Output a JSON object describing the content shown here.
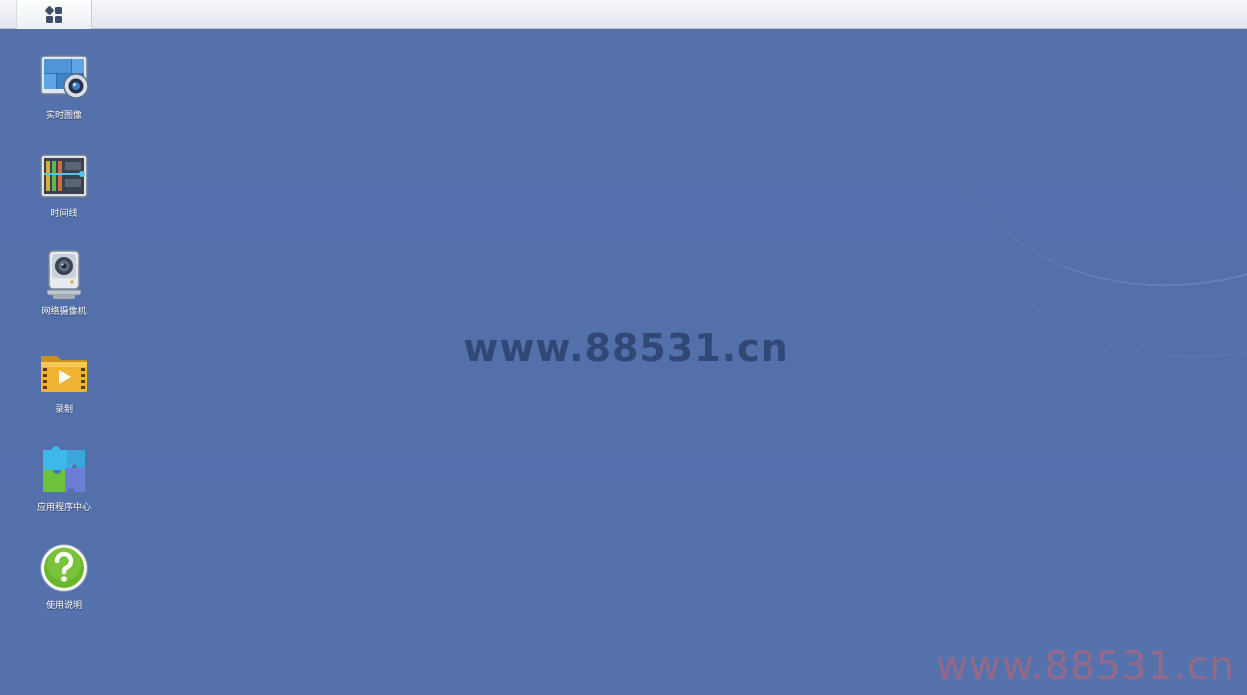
{
  "taskbar": {
    "main_menu_icon": "apps-grid-icon"
  },
  "desktop": {
    "icons": [
      {
        "label": "实时图像",
        "icon": "live-view-icon"
      },
      {
        "label": "时间线",
        "icon": "timeline-icon"
      },
      {
        "label": "网络摄像机",
        "icon": "ip-camera-icon"
      },
      {
        "label": "录制",
        "icon": "recording-folder-icon"
      },
      {
        "label": "应用程序中心",
        "icon": "app-center-icon"
      },
      {
        "label": "使用说明",
        "icon": "help-icon"
      }
    ]
  },
  "watermarks": {
    "center": "www.88531.cn",
    "corner": "www.88531.cn"
  },
  "colors": {
    "desktop_background": "#5470ab",
    "taskbar_background": "#edf0f5",
    "label_text": "#ffffff"
  }
}
